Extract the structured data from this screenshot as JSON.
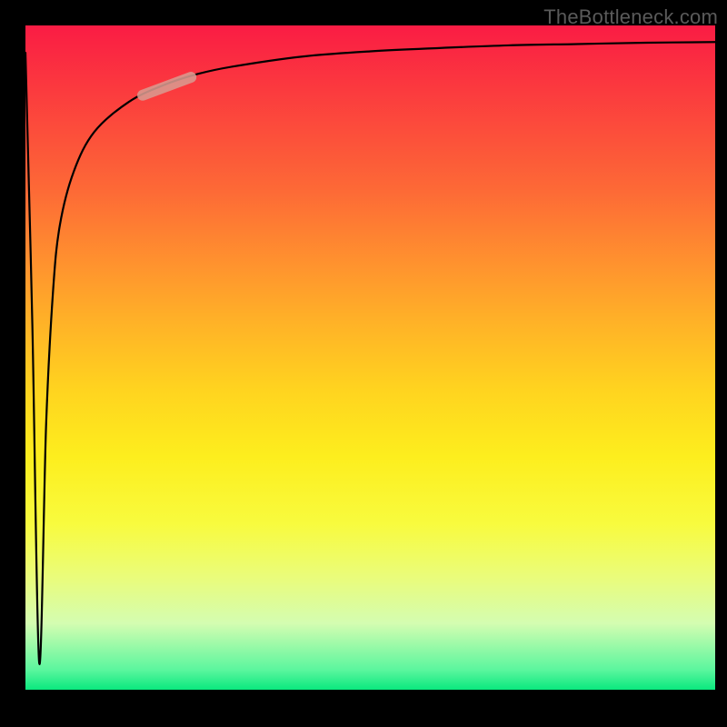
{
  "watermark": "TheBottleneck.com",
  "chart_data": {
    "type": "line",
    "title": "",
    "xlabel": "",
    "ylabel": "",
    "xlim": [
      0,
      100
    ],
    "ylim": [
      0,
      100
    ],
    "grid": false,
    "series": [
      {
        "name": "curve",
        "x": [
          0,
          1,
          2,
          3,
          4,
          5,
          7,
          10,
          15,
          20,
          25,
          30,
          40,
          50,
          60,
          70,
          80,
          90,
          100
        ],
        "y": [
          96,
          55,
          4,
          40,
          60,
          70,
          78,
          84,
          88.5,
          91,
          92.7,
          93.8,
          95.3,
          96.1,
          96.6,
          97.0,
          97.2,
          97.4,
          97.5
        ]
      }
    ],
    "marker": {
      "x": [
        17,
        24
      ],
      "y": [
        89.5,
        92.2
      ]
    },
    "background_gradient": {
      "top": "#fa1c44",
      "mid": "#ffd41f",
      "bottom": "#0ae87e"
    }
  }
}
